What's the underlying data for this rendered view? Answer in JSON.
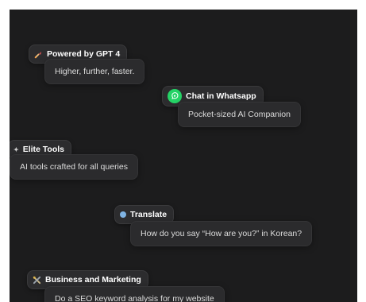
{
  "cards": [
    {
      "tag_icon": "rocket-icon",
      "tag": "Powered by GPT 4",
      "text": "Higher, further, faster."
    },
    {
      "tag_icon": "whatsapp-icon",
      "tag": "Chat in Whatsapp",
      "text": "Pocket-sized AI Companion"
    },
    {
      "tag_icon": "sparkle-icon",
      "tag": "Elite Tools",
      "text": "AI tools crafted for all queries"
    },
    {
      "tag_icon": "globe-icon",
      "tag": "Translate",
      "text": "How do you say “How are you?” in Korean?"
    },
    {
      "tag_icon": "tools-icon",
      "tag": "Business and Marketing",
      "text": "Do a SEO keyword analysis for my website"
    }
  ],
  "colors": {
    "background": "#1c1c1d",
    "card": "#2c2c2e",
    "whatsapp": "#25d366"
  }
}
